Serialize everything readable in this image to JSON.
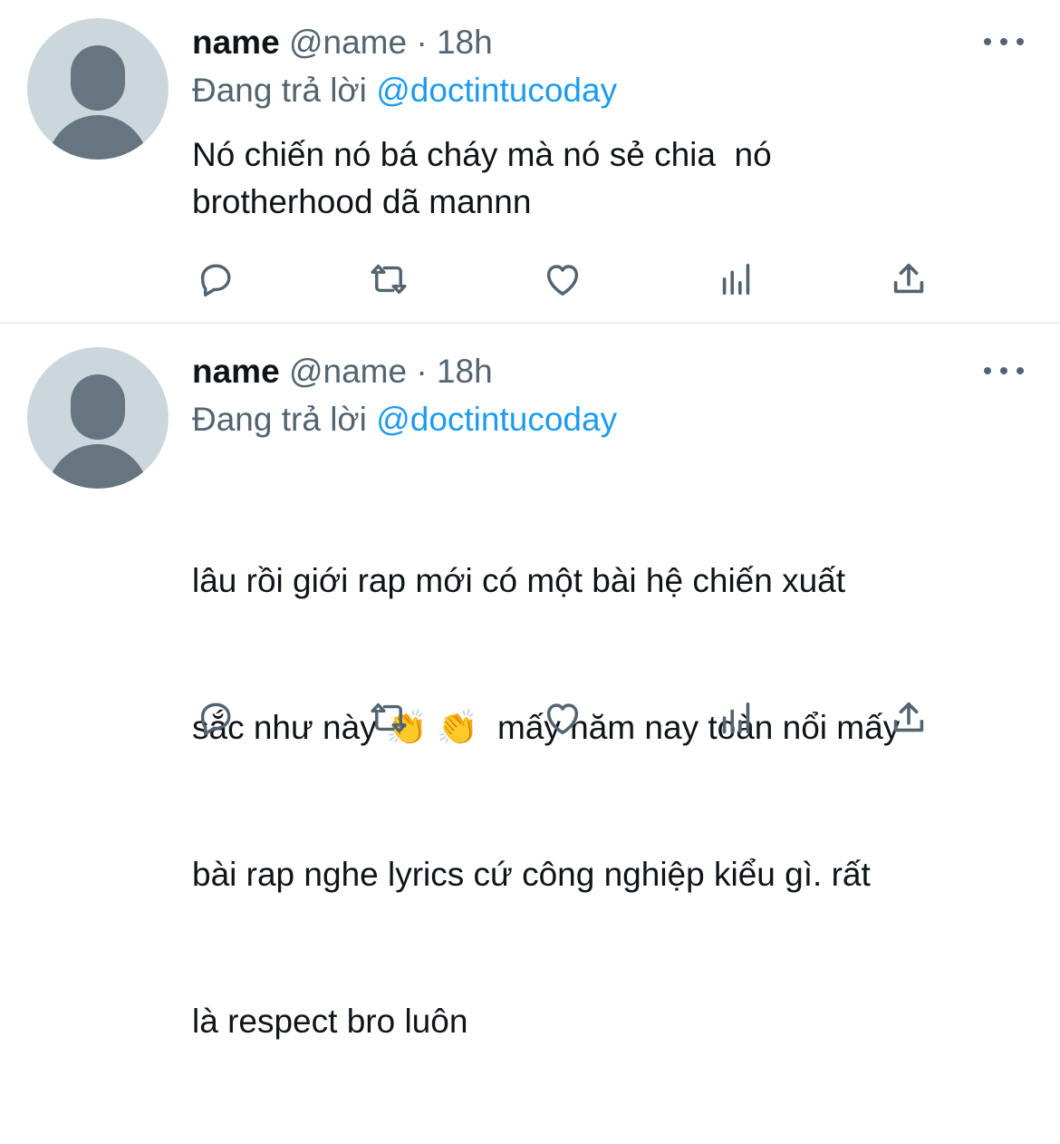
{
  "tweets": [
    {
      "name": "name",
      "handle": "@name",
      "separator": "·",
      "time": "18h",
      "replying_prefix": "Đang trả lời",
      "replying_to": "@doctintucoday",
      "text_lines": [
        "Nó chiến nó bá cháy mà nó sẻ chia  nó",
        "brotherhood dã mannn"
      ],
      "icons": [
        "reply-icon",
        "retweet-icon",
        "like-icon",
        "stats-icon",
        "share-icon",
        "more-icon"
      ]
    },
    {
      "name": "name",
      "handle": "@name",
      "separator": "·",
      "time": "18h",
      "replying_prefix": "Đang trả lời",
      "replying_to": "@doctintucoday",
      "text_lines": [
        "lâu rồi giới rap mới có một bài hệ chiến xuất",
        "sắc như này",
        "👏 👏",
        "  mấy năm nay toàn nổi mấy",
        "bài rap nghe lyrics cứ công nghiệp kiểu gì. rất",
        "là respect bro luôn"
      ],
      "icons": [
        "reply-icon",
        "retweet-icon",
        "like-icon",
        "stats-icon",
        "share-icon",
        "more-icon"
      ]
    }
  ],
  "colors": {
    "text": "#0f1419",
    "muted": "#536471",
    "mention": "#1d9bf0",
    "avatar_bg": "#ccd6dd",
    "avatar_fg": "#66757f",
    "divider": "#eff3f4"
  }
}
